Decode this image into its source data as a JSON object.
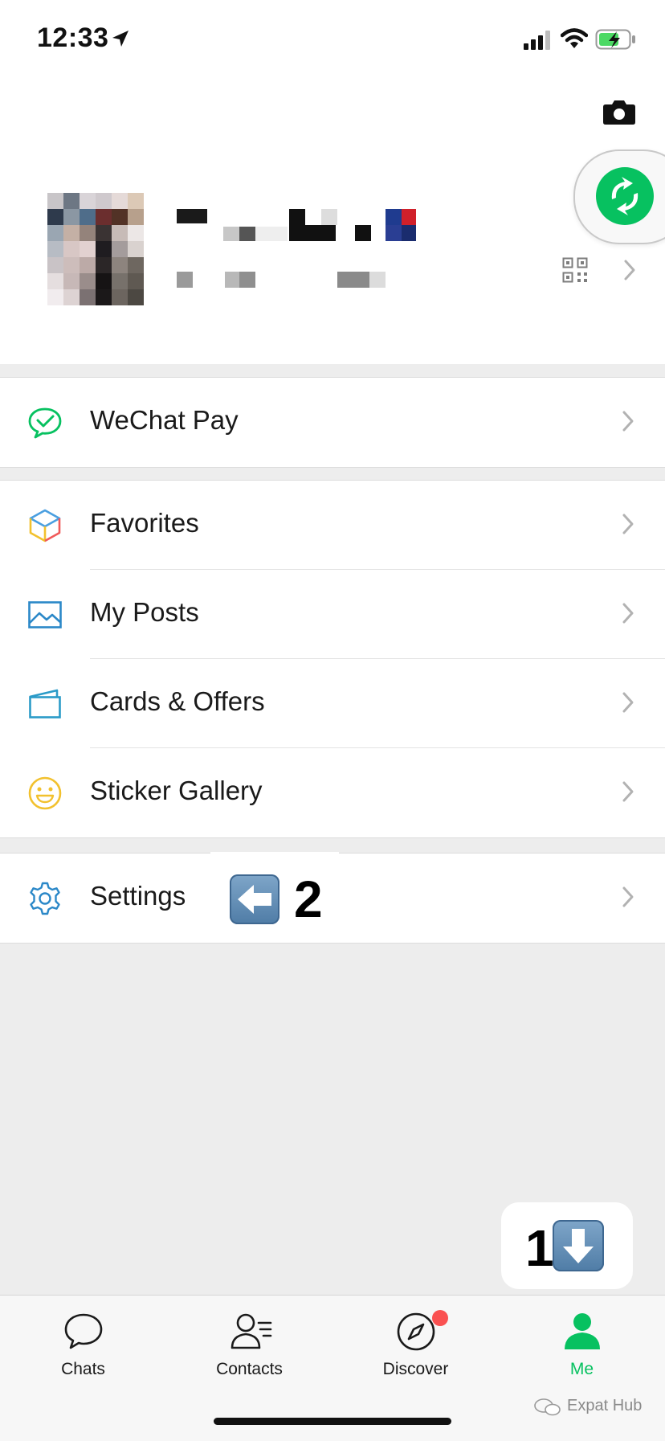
{
  "status_bar": {
    "time": "12:33"
  },
  "menu": {
    "wechat_pay": "WeChat Pay",
    "favorites": "Favorites",
    "my_posts": "My Posts",
    "cards_offers": "Cards & Offers",
    "sticker_gallery": "Sticker Gallery",
    "settings": "Settings"
  },
  "annotations": {
    "step_1": "1",
    "step_2": "2"
  },
  "tabbar": {
    "chats": "Chats",
    "contacts": "Contacts",
    "discover": "Discover",
    "me": "Me"
  },
  "watermark": "Expat Hub",
  "colors": {
    "accent": "#07c160",
    "badge": "#fa5151",
    "background": "#ededed"
  },
  "icons": [
    "location-arrow-icon",
    "signal-icon",
    "wifi-icon",
    "battery-charging-icon",
    "camera-icon",
    "mini-program-icon",
    "qr-code-icon",
    "wechat-pay-icon",
    "favorites-icon",
    "my-posts-icon",
    "cards-offers-icon",
    "sticker-gallery-icon",
    "settings-icon",
    "chats-icon",
    "contacts-icon",
    "discover-icon",
    "me-icon"
  ]
}
